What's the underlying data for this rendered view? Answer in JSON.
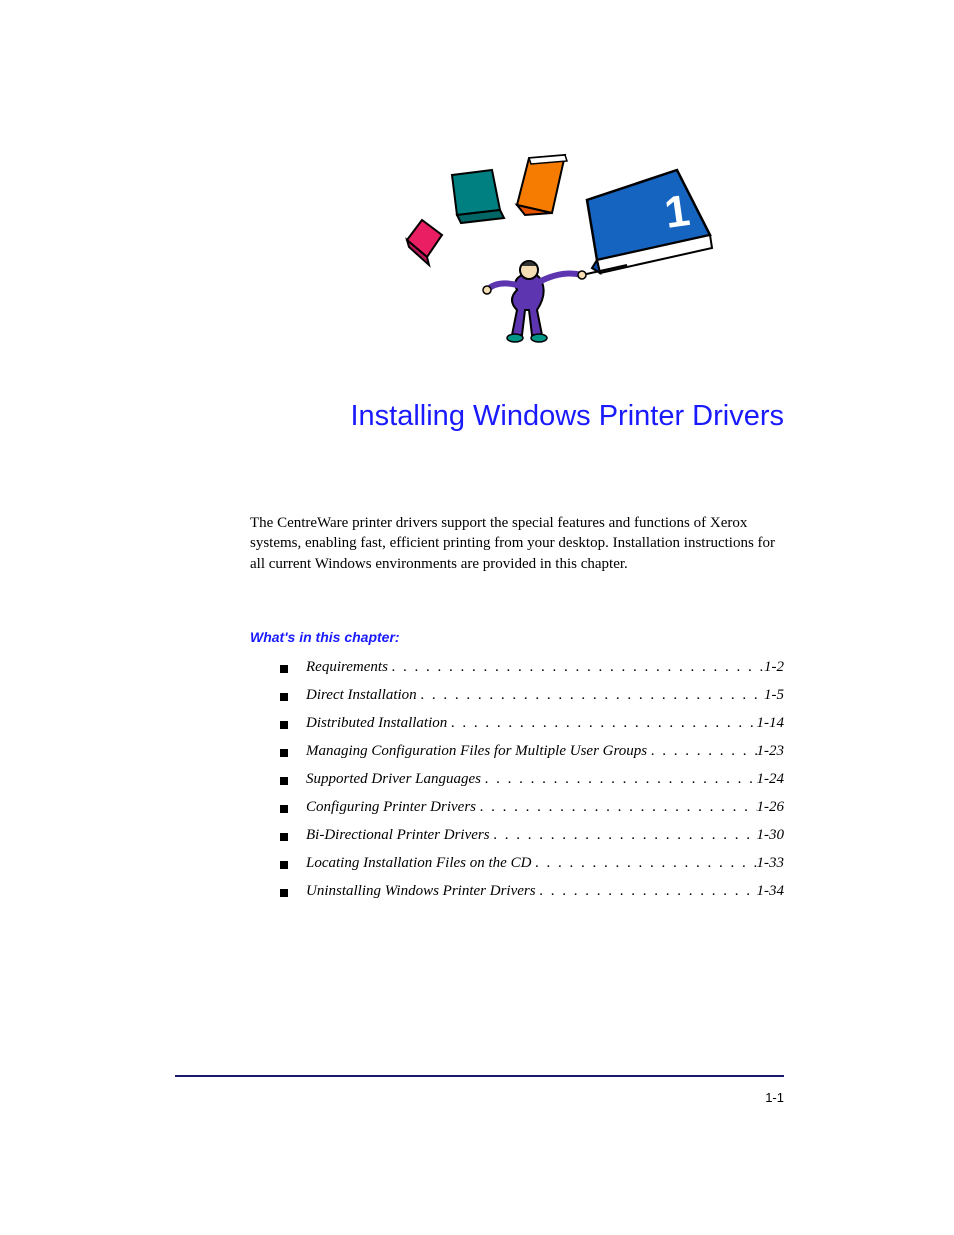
{
  "chapter": {
    "number": "1",
    "title": "Installing Windows Printer Drivers"
  },
  "intro": "The CentreWare printer drivers support the special features and functions of Xerox systems, enabling fast, efficient printing from your desktop. Installation instructions for all current Windows environments are provided in this chapter.",
  "toc": {
    "heading": "What's in this chapter:",
    "items": [
      {
        "label": "Requirements",
        "page": "1-2"
      },
      {
        "label": "Direct Installation",
        "page": "1-5"
      },
      {
        "label": "Distributed Installation",
        "page": "1-14"
      },
      {
        "label": "Managing Configuration Files for Multiple User Groups",
        "page": "1-23"
      },
      {
        "label": "Supported Driver Languages",
        "page": "1-24"
      },
      {
        "label": "Configuring Printer Drivers",
        "page": "1-26"
      },
      {
        "label": "Bi-Directional Printer Drivers",
        "page": "1-30"
      },
      {
        "label": "Locating Installation Files on the CD",
        "page": "1-33"
      },
      {
        "label": "Uninstalling Windows Printer Drivers",
        "page": "1-34"
      }
    ]
  },
  "footer": {
    "page_number": "1-1"
  }
}
